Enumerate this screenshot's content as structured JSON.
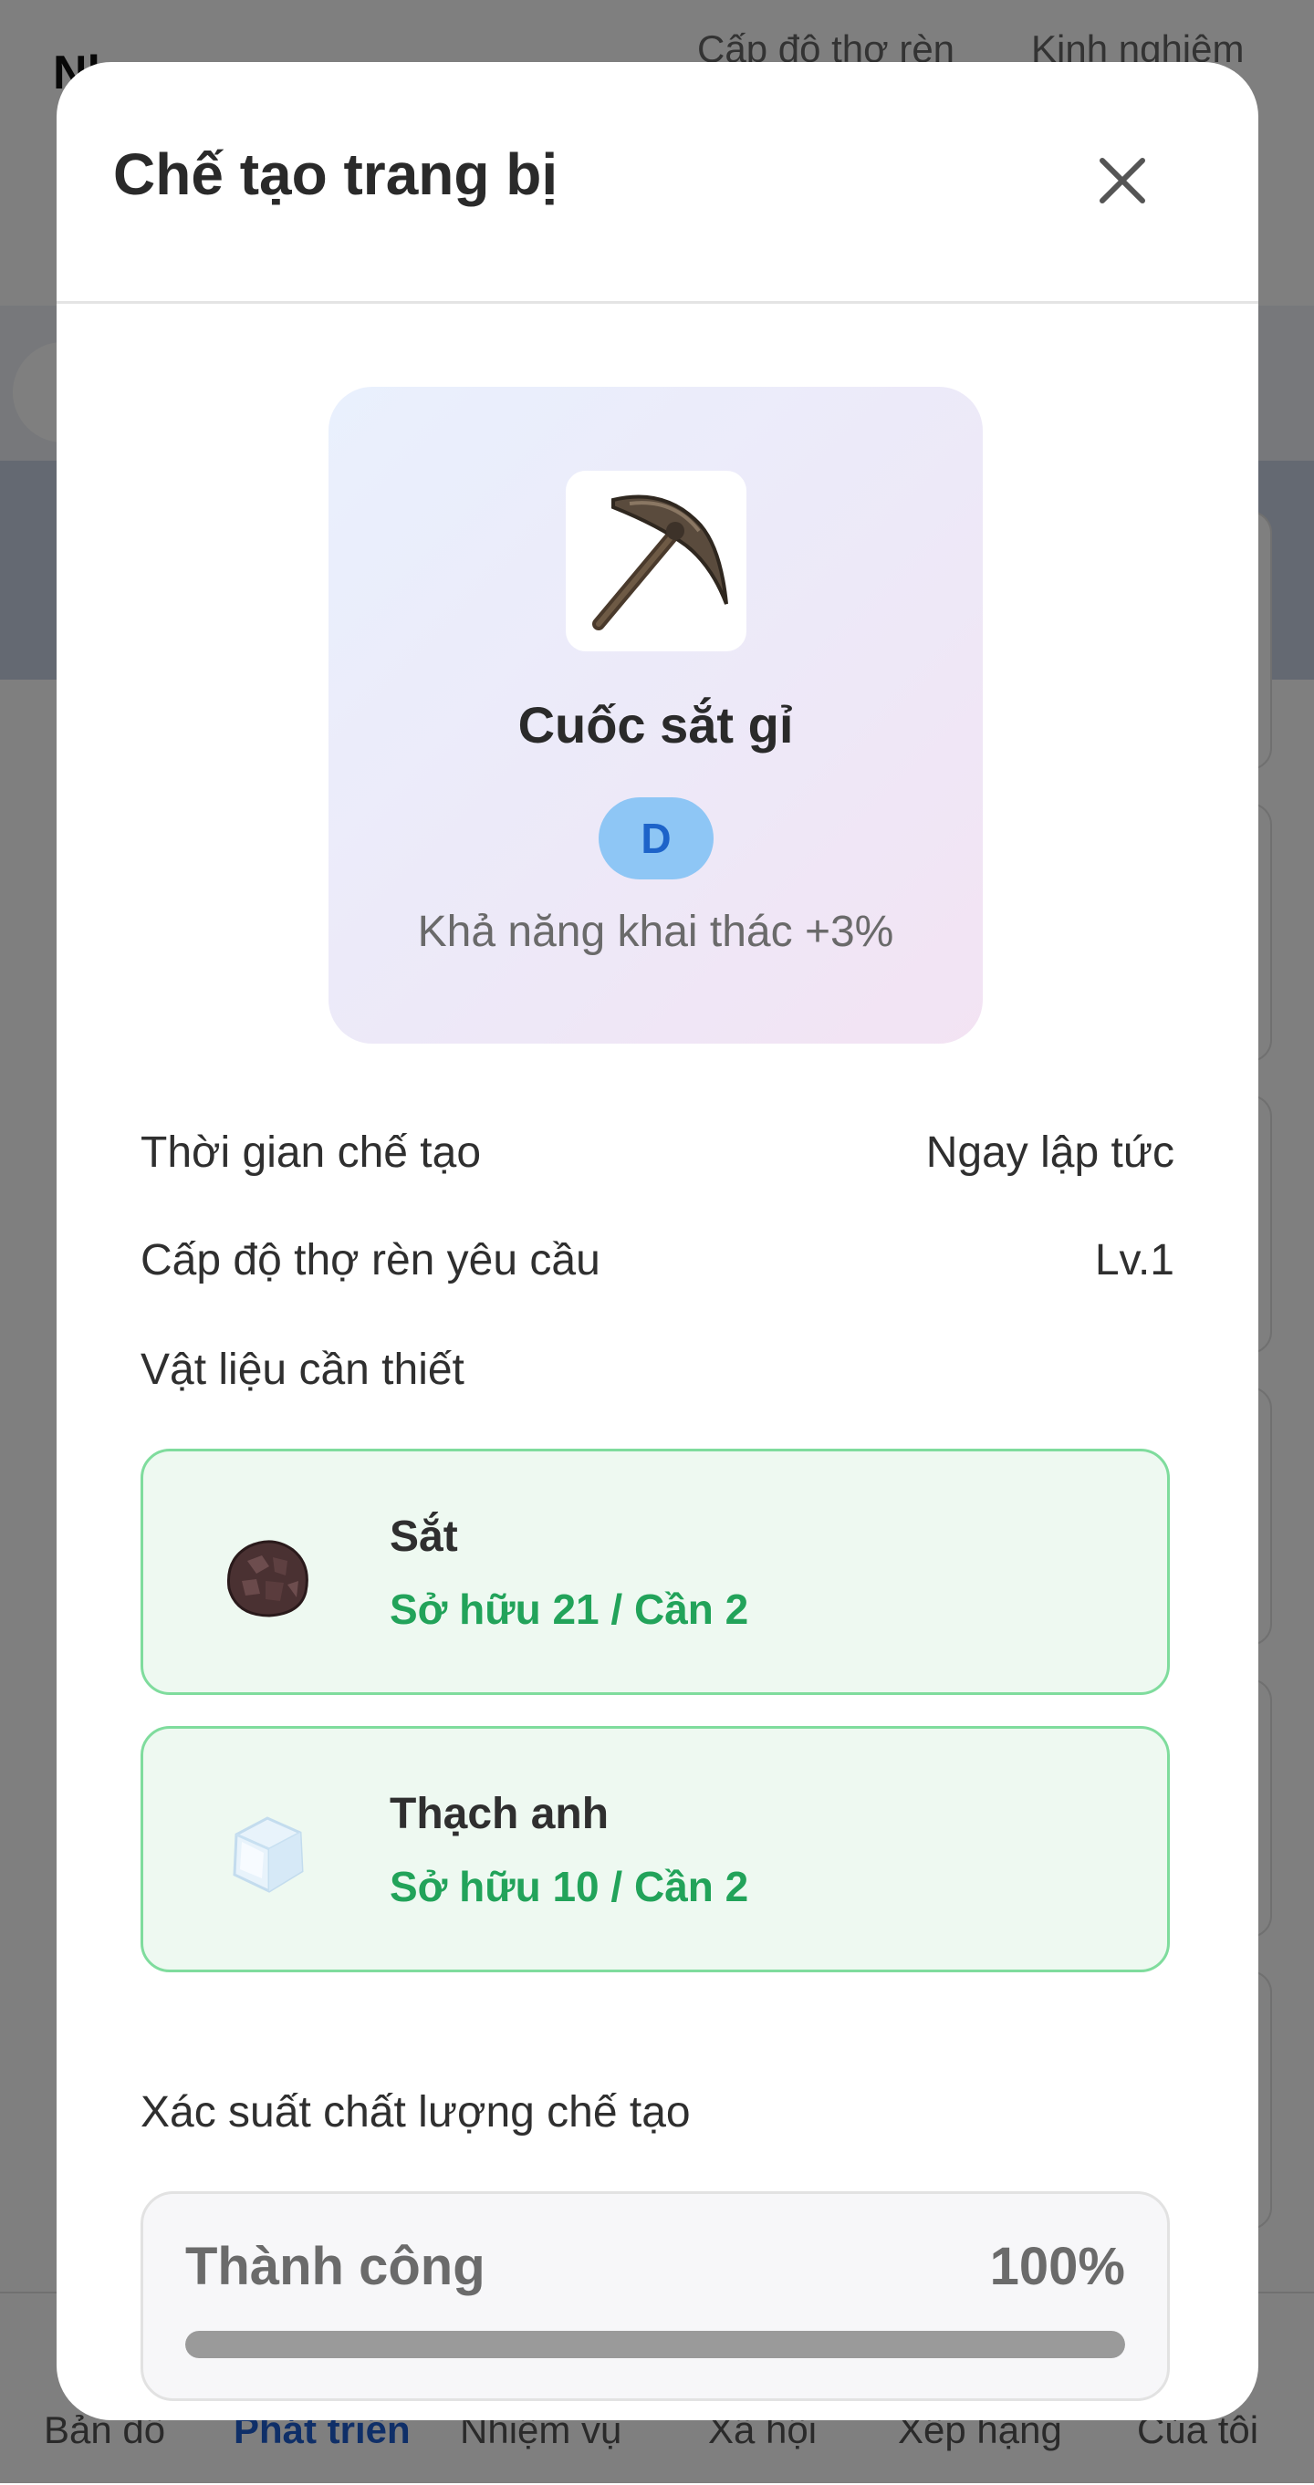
{
  "background": {
    "page_title": "Nh",
    "header_stats": [
      "Cấp độ thợ rèn",
      "Kinh nghiệm"
    ],
    "bottom_nav": [
      {
        "label": "Bản đồ",
        "active": false
      },
      {
        "label": "Phát triển",
        "active": true
      },
      {
        "label": "Nhiệm vụ",
        "active": false
      },
      {
        "label": "Xã hội",
        "active": false
      },
      {
        "label": "Xếp hạng",
        "active": false
      },
      {
        "label": "Của tôi",
        "active": false
      }
    ]
  },
  "modal": {
    "title": "Chế tạo trang bị",
    "close_icon": "close-icon",
    "item": {
      "icon": "pickaxe-icon",
      "name": "Cuốc sắt gỉ",
      "grade": "D",
      "effect": "Khả năng khai thác +3%"
    },
    "info": {
      "craft_time_label": "Thời gian chế tạo",
      "craft_time_value": "Ngay lập tức",
      "required_level_label": "Cấp độ thợ rèn yêu cầu",
      "required_level_value": "Lv.1"
    },
    "materials_label": "Vật liệu cần thiết",
    "materials": [
      {
        "name": "Sắt",
        "count": "Sở hữu 21 / Cần 2",
        "icon": "iron-ore-icon"
      },
      {
        "name": "Thạch anh",
        "count": "Sở hữu 10 / Cần 2",
        "icon": "quartz-icon"
      }
    ],
    "quality_label": "Xác suất chất lượng chế tạo",
    "quality": {
      "label": "Thành công",
      "value": "100%",
      "fraction": 1.0
    }
  },
  "colors": {
    "accent_blue": "#1f5fd1",
    "success_green": "#22a35a",
    "material_border": "#7fdc9d",
    "grade_badge_bg": "#8ec6f5"
  }
}
